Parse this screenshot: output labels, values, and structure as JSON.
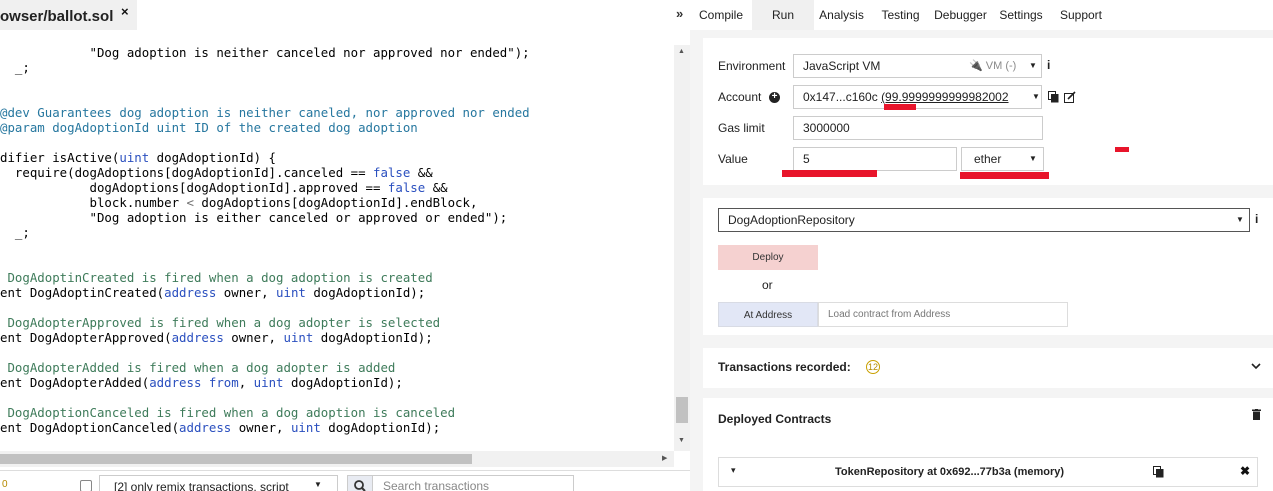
{
  "editor": {
    "file_tab": {
      "label": "owser/ballot.sol",
      "close": "×"
    },
    "code_lines": [
      [
        {
          "t": "            \"Dog adoption is neither canceled nor approved nor ended\");",
          "c": ""
        }
      ],
      [
        {
          "t": "  _;",
          "c": ""
        }
      ],
      [
        {
          "t": "",
          "c": ""
        }
      ],
      [
        {
          "t": "",
          "c": ""
        }
      ],
      [
        {
          "t": "@dev Guarantees dog adoption is neither caneled, nor approved nor ended",
          "c": "cm"
        }
      ],
      [
        {
          "t": "@param dogAdoptionId uint ID of the created dog adoption",
          "c": "cm"
        }
      ],
      [
        {
          "t": "",
          "c": ""
        }
      ],
      [
        {
          "t": "difier isActive(",
          "c": ""
        },
        {
          "t": "uint",
          "c": "kw"
        },
        {
          "t": " dogAdoptionId) {",
          "c": ""
        }
      ],
      [
        {
          "t": "  require(dogAdoptions[dogAdoptionId].canceled == ",
          "c": ""
        },
        {
          "t": "false",
          "c": "kw"
        },
        {
          "t": " &&",
          "c": ""
        }
      ],
      [
        {
          "t": "            dogAdoptions[dogAdoptionId].approved == ",
          "c": ""
        },
        {
          "t": "false",
          "c": "kw"
        },
        {
          "t": " &&",
          "c": ""
        }
      ],
      [
        {
          "t": "            block.number ",
          "c": ""
        },
        {
          "t": "<",
          "c": "gy"
        },
        {
          "t": " dogAdoptions[dogAdoptionId].endBlock,",
          "c": ""
        }
      ],
      [
        {
          "t": "            \"Dog adoption is either canceled or approved or ended\");",
          "c": ""
        }
      ],
      [
        {
          "t": "  _;",
          "c": ""
        }
      ],
      [
        {
          "t": "",
          "c": ""
        }
      ],
      [
        {
          "t": "",
          "c": ""
        }
      ],
      [
        {
          "t": " DogAdoptinCreated is fired when a dog adoption is created",
          "c": "cg"
        }
      ],
      [
        {
          "t": "ent DogAdoptinCreated(",
          "c": ""
        },
        {
          "t": "address",
          "c": "kw"
        },
        {
          "t": " owner, ",
          "c": ""
        },
        {
          "t": "uint",
          "c": "kw"
        },
        {
          "t": " dogAdoptionId);",
          "c": ""
        }
      ],
      [
        {
          "t": "",
          "c": ""
        }
      ],
      [
        {
          "t": " DogAdopterApproved is fired when a dog adopter is selected",
          "c": "cg"
        }
      ],
      [
        {
          "t": "ent DogAdopterApproved(",
          "c": ""
        },
        {
          "t": "address",
          "c": "kw"
        },
        {
          "t": " owner, ",
          "c": ""
        },
        {
          "t": "uint",
          "c": "kw"
        },
        {
          "t": " dogAdoptionId);",
          "c": ""
        }
      ],
      [
        {
          "t": "",
          "c": ""
        }
      ],
      [
        {
          "t": " DogAdopterAdded is fired when a dog adopter is added",
          "c": "cg"
        }
      ],
      [
        {
          "t": "ent DogAdopterAdded(",
          "c": ""
        },
        {
          "t": "address",
          "c": "kw"
        },
        {
          "t": " ",
          "c": ""
        },
        {
          "t": "from",
          "c": "kw"
        },
        {
          "t": ", ",
          "c": ""
        },
        {
          "t": "uint",
          "c": "kw"
        },
        {
          "t": " dogAdoptionId);",
          "c": ""
        }
      ],
      [
        {
          "t": "",
          "c": ""
        }
      ],
      [
        {
          "t": " DogAdoptionCanceled is fired when a dog adoption is canceled",
          "c": "cg"
        }
      ],
      [
        {
          "t": "ent DogAdoptionCanceled(",
          "c": ""
        },
        {
          "t": "address",
          "c": "kw"
        },
        {
          "t": " owner, ",
          "c": ""
        },
        {
          "t": "uint",
          "c": "kw"
        },
        {
          "t": " dogAdoptionId);",
          "c": ""
        }
      ]
    ]
  },
  "terminal": {
    "count_badge": "0",
    "filter_label": "[2] only remix transactions, script",
    "search_placeholder": "Search transactions"
  },
  "tabs": {
    "toggle": "»",
    "items": [
      {
        "label": "Compile",
        "active": false
      },
      {
        "label": "Run",
        "active": true
      },
      {
        "label": "Analysis",
        "active": false
      },
      {
        "label": "Testing",
        "active": false
      },
      {
        "label": "Debugger",
        "active": false
      },
      {
        "label": "Settings",
        "active": false
      },
      {
        "label": "Support",
        "active": false
      }
    ]
  },
  "run": {
    "environment": {
      "label": "Environment",
      "value": "JavaScript VM",
      "secondary": "VM (-)",
      "info": "i"
    },
    "account": {
      "label": "Account",
      "address": "0x147...c160c",
      "balance": "(99.9999999999982002"
    },
    "gas_limit": {
      "label": "Gas limit",
      "value": "3000000"
    },
    "value": {
      "label": "Value",
      "amount": "5",
      "unit": "ether"
    },
    "contract": {
      "selected": "DogAdoptionRepository",
      "info": "i"
    },
    "deploy_label": "Deploy",
    "or_text": "or",
    "at_address_label": "At Address",
    "at_address_placeholder": "Load contract from Address",
    "transactions_recorded": {
      "label": "Transactions recorded:",
      "count": "12"
    },
    "deployed": {
      "label": "Deployed Contracts",
      "instances": [
        {
          "name": "TokenRepository at 0x692...77b3a (memory)"
        }
      ]
    }
  },
  "colors": {
    "annotation_red": "#e8152b",
    "deploy_bg": "#f5d1d0",
    "at_address_bg": "#e2e7f6",
    "keyword_blue": "#2a4fbf",
    "natspec_comment": "#26779f",
    "event_comment": "#3e7b5a"
  }
}
